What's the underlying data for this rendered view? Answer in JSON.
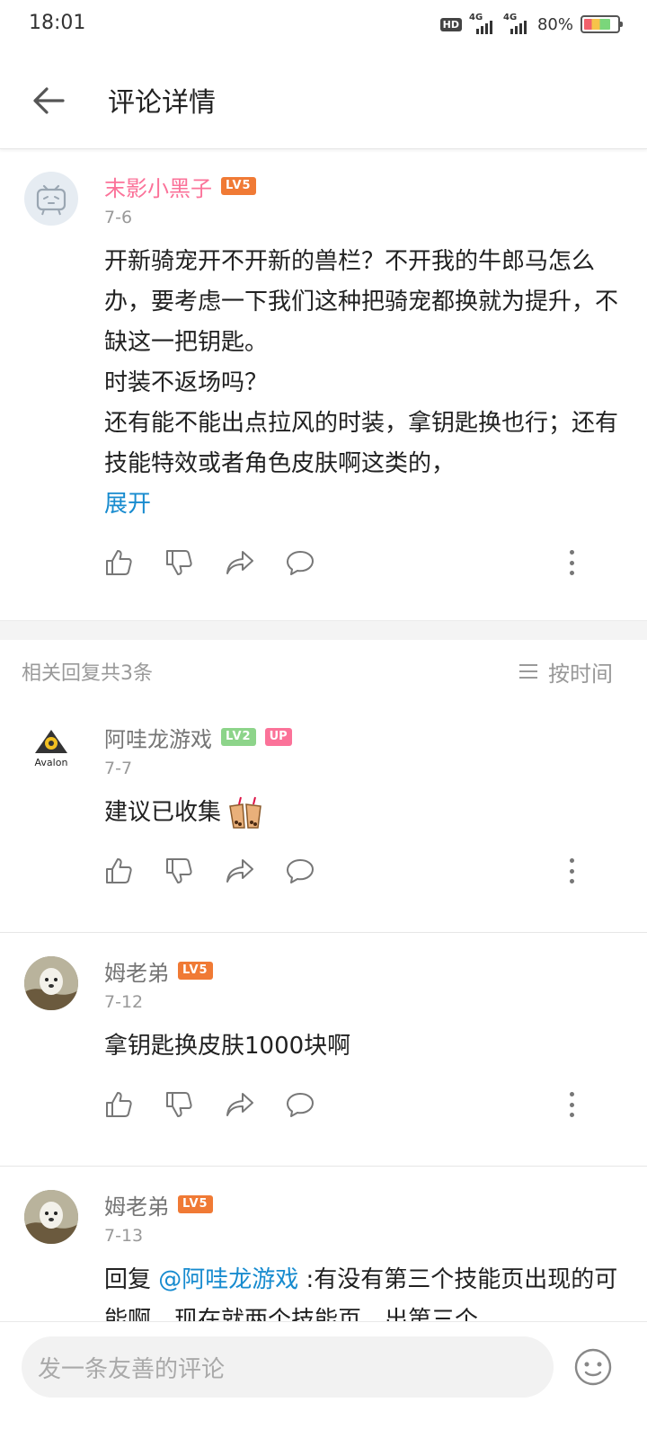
{
  "status": {
    "time": "18:01",
    "hd_label": "HD",
    "net1": "4G",
    "net2": "4G",
    "battery_pct": "80%",
    "battery_level": 0.8
  },
  "header": {
    "title": "评论详情"
  },
  "main_comment": {
    "user": "末影小黑子",
    "level": "LV5",
    "date": "7-6",
    "text": "开新骑宠开不开新的兽栏？不开我的牛郎马怎么办，要考虑一下我们这种把骑宠都换就为提升，不缺这一把钥匙。\n时装不返场吗？\n还有能不能出点拉风的时装，拿钥匙换也行；还有技能特效或者角色皮肤啊这类的，",
    "expand_label": "展开"
  },
  "replies_header": {
    "count_label": "相关回复共3条",
    "sort_label": "按时间"
  },
  "replies": [
    {
      "user": "阿哇龙游戏",
      "level": "LV2",
      "up_badge": "UP",
      "date": "7-7",
      "text": "建议已收集",
      "avatar_text": "Avalon"
    },
    {
      "user": "姆老弟",
      "level": "LV5",
      "date": "7-12",
      "text": "拿钥匙换皮肤1000块啊"
    },
    {
      "user": "姆老弟",
      "level": "LV5",
      "date": "7-13",
      "reply_prefix": "回复 ",
      "mention": "@阿哇龙游戏",
      "text": " :有没有第三个技能页出现的可能啊，现在就两个技能页，出第三个"
    }
  ],
  "composer": {
    "placeholder": "发一条友善的评论"
  }
}
